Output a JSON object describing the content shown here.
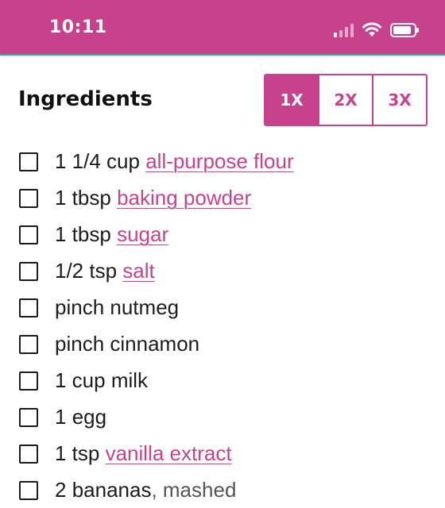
{
  "status_bar": {
    "time": "10:11",
    "background_color": "#c8418c",
    "icons": [
      "signal-icon",
      "wifi-icon",
      "battery-icon"
    ]
  },
  "ingredients_section": {
    "title": "Ingredients",
    "scale_options": [
      {
        "label": "1X",
        "selected": true
      },
      {
        "label": "2X",
        "selected": false
      },
      {
        "label": "3X",
        "selected": false
      }
    ],
    "items": [
      {
        "amount": "1 1/4 cup ",
        "name": "all-purpose flour",
        "is_link": true,
        "note": "",
        "checked": false
      },
      {
        "amount": "1 tbsp ",
        "name": "baking powder",
        "is_link": true,
        "note": "",
        "checked": false
      },
      {
        "amount": "1 tbsp ",
        "name": "sugar",
        "is_link": true,
        "note": "",
        "checked": false
      },
      {
        "amount": "1/2 tsp ",
        "name": "salt",
        "is_link": true,
        "note": "",
        "checked": false
      },
      {
        "amount": "pinch ",
        "name": "nutmeg",
        "is_link": false,
        "note": "",
        "checked": false
      },
      {
        "amount": "pinch ",
        "name": "cinnamon",
        "is_link": false,
        "note": "",
        "checked": false
      },
      {
        "amount": "1 cup ",
        "name": "milk",
        "is_link": false,
        "note": "",
        "checked": false
      },
      {
        "amount": "1 ",
        "name": "egg",
        "is_link": false,
        "note": "",
        "checked": false
      },
      {
        "amount": "1 tsp ",
        "name": "vanilla extract",
        "is_link": true,
        "note": "",
        "checked": false
      },
      {
        "amount": "2 ",
        "name": "bananas",
        "is_link": false,
        "note": ", mashed",
        "checked": false
      }
    ]
  },
  "colors": {
    "accent": "#c8418c",
    "divider": "#3da59b",
    "text": "#1c1c1c"
  }
}
